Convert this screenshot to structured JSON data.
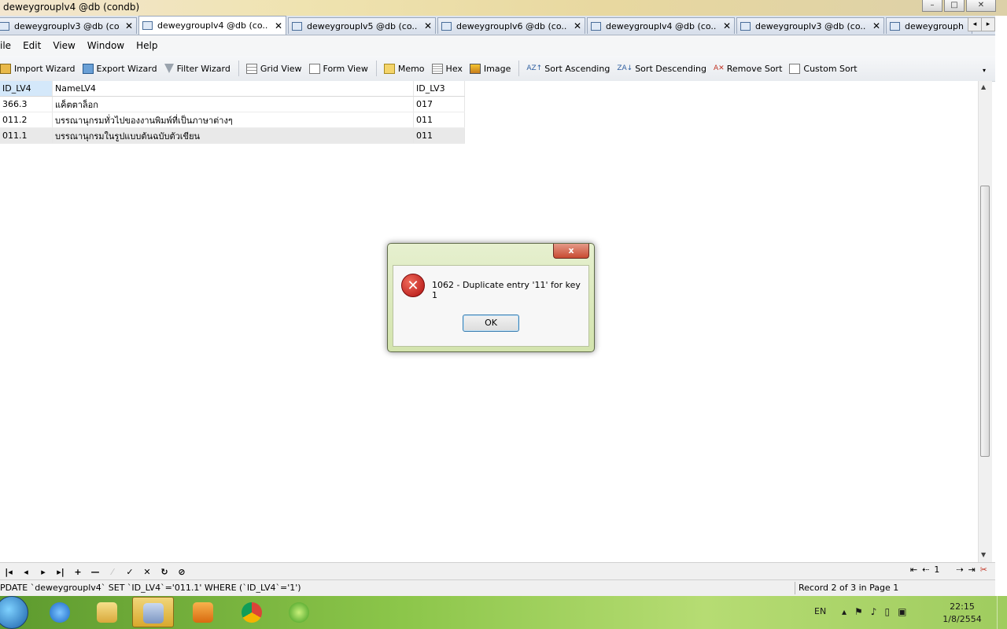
{
  "window": {
    "title": "deweygrouplv4 @db (condb)",
    "buttons": [
      "–",
      "□",
      "✕"
    ]
  },
  "tabs": [
    {
      "label": "deweygrouplv3 @db (co...",
      "active": false
    },
    {
      "label": "deweygrouplv4 @db (co...",
      "active": true
    },
    {
      "label": "deweygrouplv5 @db (co...",
      "active": false
    },
    {
      "label": "deweygrouplv6 @db (co...",
      "active": false
    },
    {
      "label": "deweygrouplv4 @db (co...",
      "active": false
    },
    {
      "label": "deweygrouplv3 @db (co...",
      "active": false
    },
    {
      "label": "deweygrouph",
      "active": false
    }
  ],
  "menu": [
    "ile",
    "Edit",
    "View",
    "Window",
    "Help"
  ],
  "toolbar": {
    "import_wizard": "Import Wizard",
    "export_wizard": "Export Wizard",
    "filter_wizard": "Filter Wizard",
    "grid_view": "Grid View",
    "form_view": "Form View",
    "memo": "Memo",
    "hex": "Hex",
    "image": "Image",
    "sort_ascending": "Sort Ascending",
    "sort_descending": "Sort Descending",
    "remove_sort": "Remove Sort",
    "custom_sort": "Custom Sort"
  },
  "grid": {
    "columns": [
      "ID_LV4",
      "NameLV4",
      "ID_LV3"
    ],
    "rows": [
      [
        "366.3",
        "แค็ตตาล็อก",
        "017"
      ],
      [
        "011.2",
        "บรรณานุกรมทั่วไปของงานพิมพ์ที่เป็นภาษาต่างๆ",
        "011"
      ],
      [
        "011.1",
        "บรรณานุกรมในรูปแบบต้นฉบับตัวเขียน",
        "011"
      ]
    ]
  },
  "dialog": {
    "close": "x",
    "message": "1062 - Duplicate entry '11' for key 1",
    "ok": "OK",
    "icon": "error-icon"
  },
  "navbar": {
    "buttons": [
      "|◂",
      "◂",
      "▸",
      "▸|",
      "+",
      "—",
      "⁄",
      "✓",
      "✕",
      "↻",
      "⊘"
    ],
    "page_value": "1"
  },
  "status": {
    "sql": "PDATE `deweygrouplv4` SET `ID_LV4`='011.1' WHERE (`ID_LV4`='1')",
    "record": "Record 2 of 3 in Page 1"
  },
  "tray": {
    "lang": "EN",
    "time": "22:15",
    "date": "1/8/2554"
  },
  "colors": {
    "accent": "#3c7fb1",
    "error": "#b01010",
    "taskbar": "#8cc64a"
  }
}
